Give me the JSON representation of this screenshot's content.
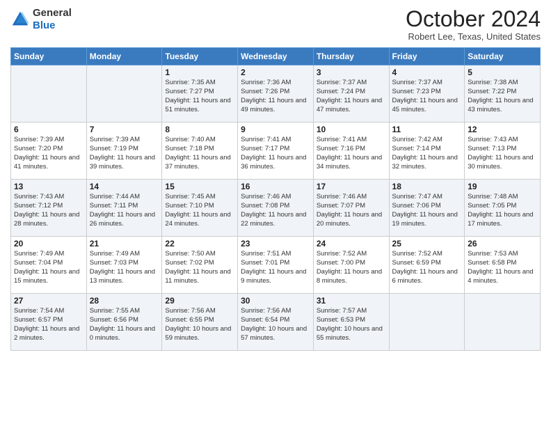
{
  "header": {
    "logo_line1": "General",
    "logo_line2": "Blue",
    "month_title": "October 2024",
    "location": "Robert Lee, Texas, United States"
  },
  "days_of_week": [
    "Sunday",
    "Monday",
    "Tuesday",
    "Wednesday",
    "Thursday",
    "Friday",
    "Saturday"
  ],
  "weeks": [
    [
      {
        "day": "",
        "info": ""
      },
      {
        "day": "",
        "info": ""
      },
      {
        "day": "1",
        "info": "Sunrise: 7:35 AM\nSunset: 7:27 PM\nDaylight: 11 hours and 51 minutes."
      },
      {
        "day": "2",
        "info": "Sunrise: 7:36 AM\nSunset: 7:26 PM\nDaylight: 11 hours and 49 minutes."
      },
      {
        "day": "3",
        "info": "Sunrise: 7:37 AM\nSunset: 7:24 PM\nDaylight: 11 hours and 47 minutes."
      },
      {
        "day": "4",
        "info": "Sunrise: 7:37 AM\nSunset: 7:23 PM\nDaylight: 11 hours and 45 minutes."
      },
      {
        "day": "5",
        "info": "Sunrise: 7:38 AM\nSunset: 7:22 PM\nDaylight: 11 hours and 43 minutes."
      }
    ],
    [
      {
        "day": "6",
        "info": "Sunrise: 7:39 AM\nSunset: 7:20 PM\nDaylight: 11 hours and 41 minutes."
      },
      {
        "day": "7",
        "info": "Sunrise: 7:39 AM\nSunset: 7:19 PM\nDaylight: 11 hours and 39 minutes."
      },
      {
        "day": "8",
        "info": "Sunrise: 7:40 AM\nSunset: 7:18 PM\nDaylight: 11 hours and 37 minutes."
      },
      {
        "day": "9",
        "info": "Sunrise: 7:41 AM\nSunset: 7:17 PM\nDaylight: 11 hours and 36 minutes."
      },
      {
        "day": "10",
        "info": "Sunrise: 7:41 AM\nSunset: 7:16 PM\nDaylight: 11 hours and 34 minutes."
      },
      {
        "day": "11",
        "info": "Sunrise: 7:42 AM\nSunset: 7:14 PM\nDaylight: 11 hours and 32 minutes."
      },
      {
        "day": "12",
        "info": "Sunrise: 7:43 AM\nSunset: 7:13 PM\nDaylight: 11 hours and 30 minutes."
      }
    ],
    [
      {
        "day": "13",
        "info": "Sunrise: 7:43 AM\nSunset: 7:12 PM\nDaylight: 11 hours and 28 minutes."
      },
      {
        "day": "14",
        "info": "Sunrise: 7:44 AM\nSunset: 7:11 PM\nDaylight: 11 hours and 26 minutes."
      },
      {
        "day": "15",
        "info": "Sunrise: 7:45 AM\nSunset: 7:10 PM\nDaylight: 11 hours and 24 minutes."
      },
      {
        "day": "16",
        "info": "Sunrise: 7:46 AM\nSunset: 7:08 PM\nDaylight: 11 hours and 22 minutes."
      },
      {
        "day": "17",
        "info": "Sunrise: 7:46 AM\nSunset: 7:07 PM\nDaylight: 11 hours and 20 minutes."
      },
      {
        "day": "18",
        "info": "Sunrise: 7:47 AM\nSunset: 7:06 PM\nDaylight: 11 hours and 19 minutes."
      },
      {
        "day": "19",
        "info": "Sunrise: 7:48 AM\nSunset: 7:05 PM\nDaylight: 11 hours and 17 minutes."
      }
    ],
    [
      {
        "day": "20",
        "info": "Sunrise: 7:49 AM\nSunset: 7:04 PM\nDaylight: 11 hours and 15 minutes."
      },
      {
        "day": "21",
        "info": "Sunrise: 7:49 AM\nSunset: 7:03 PM\nDaylight: 11 hours and 13 minutes."
      },
      {
        "day": "22",
        "info": "Sunrise: 7:50 AM\nSunset: 7:02 PM\nDaylight: 11 hours and 11 minutes."
      },
      {
        "day": "23",
        "info": "Sunrise: 7:51 AM\nSunset: 7:01 PM\nDaylight: 11 hours and 9 minutes."
      },
      {
        "day": "24",
        "info": "Sunrise: 7:52 AM\nSunset: 7:00 PM\nDaylight: 11 hours and 8 minutes."
      },
      {
        "day": "25",
        "info": "Sunrise: 7:52 AM\nSunset: 6:59 PM\nDaylight: 11 hours and 6 minutes."
      },
      {
        "day": "26",
        "info": "Sunrise: 7:53 AM\nSunset: 6:58 PM\nDaylight: 11 hours and 4 minutes."
      }
    ],
    [
      {
        "day": "27",
        "info": "Sunrise: 7:54 AM\nSunset: 6:57 PM\nDaylight: 11 hours and 2 minutes."
      },
      {
        "day": "28",
        "info": "Sunrise: 7:55 AM\nSunset: 6:56 PM\nDaylight: 11 hours and 0 minutes."
      },
      {
        "day": "29",
        "info": "Sunrise: 7:56 AM\nSunset: 6:55 PM\nDaylight: 10 hours and 59 minutes."
      },
      {
        "day": "30",
        "info": "Sunrise: 7:56 AM\nSunset: 6:54 PM\nDaylight: 10 hours and 57 minutes."
      },
      {
        "day": "31",
        "info": "Sunrise: 7:57 AM\nSunset: 6:53 PM\nDaylight: 10 hours and 55 minutes."
      },
      {
        "day": "",
        "info": ""
      },
      {
        "day": "",
        "info": ""
      }
    ]
  ]
}
